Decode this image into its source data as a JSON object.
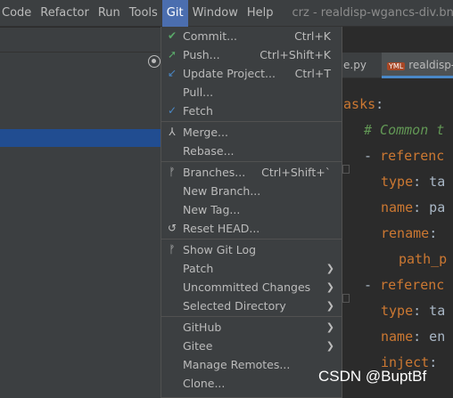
{
  "menubar": {
    "items": [
      "Code",
      "Refactor",
      "Run",
      "Tools",
      "Git",
      "Window",
      "Help"
    ],
    "title": "crz - realdisp-wgancs-div.bnod"
  },
  "editor": {
    "tabs": [
      "e.py",
      "realdisp-"
    ],
    "tab_icon_text": "YML",
    "code": [
      {
        "key": "tasks",
        "rest": ":"
      },
      {
        "comment": "# Common t"
      },
      {
        "prefix": "- ",
        "key": "referenc",
        "rest": ""
      },
      {
        "key": "type",
        "rest": ": ta"
      },
      {
        "key": "name",
        "rest": ": pa"
      },
      {
        "key": "rename",
        "rest": ":"
      },
      {
        "key": "path_p",
        "rest": ""
      },
      {
        "prefix": "- ",
        "key": "referenc",
        "rest": ""
      },
      {
        "key": "type",
        "rest": ": ta"
      },
      {
        "key": "name",
        "rest": ": en"
      },
      {
        "key": "inject",
        "rest": ":"
      }
    ]
  },
  "git_menu": {
    "items": [
      {
        "label": "Commit...",
        "shortcut": "Ctrl+K",
        "icon": "check-icon"
      },
      {
        "label": "Push...",
        "shortcut": "Ctrl+Shift+K",
        "icon": "push-arrow-icon"
      },
      {
        "label": "Update Project...",
        "shortcut": "Ctrl+T",
        "icon": "update-arrow-icon"
      },
      {
        "label": "Pull...",
        "shortcut": "",
        "icon": ""
      },
      {
        "label": "Fetch",
        "shortcut": "",
        "icon": "fetch-icon"
      },
      {
        "label": "Merge...",
        "shortcut": "",
        "icon": "merge-icon"
      },
      {
        "label": "Rebase...",
        "shortcut": "",
        "icon": ""
      },
      {
        "label": "Branches...",
        "shortcut": "Ctrl+Shift+`",
        "icon": "branch-icon"
      },
      {
        "label": "New Branch...",
        "shortcut": "",
        "icon": ""
      },
      {
        "label": "New Tag...",
        "shortcut": "",
        "icon": ""
      },
      {
        "label": "Reset HEAD...",
        "shortcut": "",
        "icon": "reset-icon"
      },
      {
        "label": "Show Git Log",
        "shortcut": "",
        "icon": "git-log-icon"
      },
      {
        "label": "Patch",
        "shortcut": "",
        "icon": "",
        "submenu": true
      },
      {
        "label": "Uncommitted Changes",
        "shortcut": "",
        "icon": "",
        "submenu": true
      },
      {
        "label": "Selected Directory",
        "shortcut": "",
        "icon": "",
        "submenu": true
      },
      {
        "label": "GitHub",
        "shortcut": "",
        "icon": "",
        "submenu": true
      },
      {
        "label": "Gitee",
        "shortcut": "",
        "icon": "",
        "submenu": true
      },
      {
        "label": "Manage Remotes...",
        "shortcut": "",
        "icon": ""
      },
      {
        "label": "Clone...",
        "shortcut": "",
        "icon": ""
      }
    ]
  },
  "watermark": "CSDN @BuptBf",
  "colors": {
    "menu_bg": "#3c3f41",
    "active_menu": "#4b6eaf",
    "editor_bg": "#2b2b2b",
    "keyword": "#cc7832",
    "comment": "#629755",
    "check_green": "#59a869",
    "arrow_blue": "#4a88c7"
  }
}
